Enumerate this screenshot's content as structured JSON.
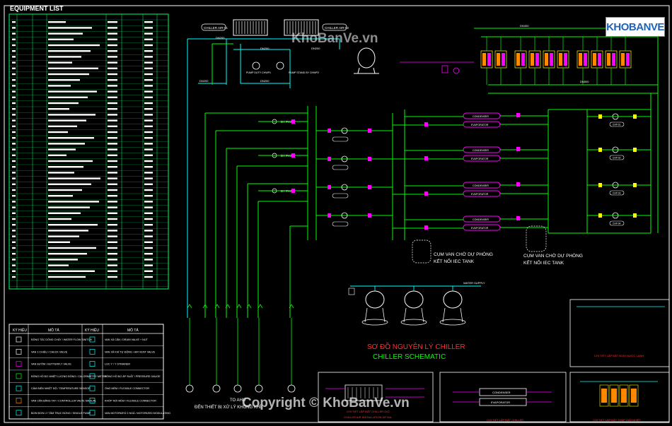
{
  "equipment_list": {
    "title": "EQUIPMENT LIST"
  },
  "legend": {
    "headers": [
      "KÝ HIỆU",
      "MÔ TẢ",
      "KÝ HIỆU",
      "MÔ TẢ"
    ],
    "left_items": [
      "ĐỒNG TẮC DÒNG CHẢY / WATER FLOW SWITCH",
      "VAN 1 CHIỀU / CHECK VALVE",
      "VAN BƯỚM / BUTTERFLY VALVE",
      "ĐỒNG HỒ ĐO NHIỆT LƯỢNG ĐỒNG / CALORIMETRY METER",
      "CẢM BIẾN NHIỆT ĐỘ / TEMPERATURE SENSOR",
      "VAN CÂN BẰNG TAY / CONTROLLER VALVE MANUAL",
      "BƠM ĐƠN LY TÂM TRỤC ĐỨNG / SINGLE PUMP"
    ],
    "right_items": [
      "VAN XẢ CẶN / DRAIN VALVE + NUT",
      "VAN XẢ KHÍ TỰ ĐỘNG / AIR VENT VALVE",
      "LỌC Y / Y STRAINER",
      "ĐỒNG HỒ ĐO ÁP SUẤT / PRESSURE GAUGE",
      "ỐNG MỀM / FLEXIBLE CONNECTOR",
      "KHỚP NỐI MỀM / FLEXIBLE CONNECTOR",
      "VAN MOTORIZED 2 NGẢ / MOTORIZED MODULATING"
    ]
  },
  "top_left": {
    "chiller_labels": [
      "CHILLER AIR-01",
      "CHILLER AIR-02"
    ],
    "pump_labels": [
      "PUMP DUTY CHWP1",
      "PUMP STAND BY CHWP2"
    ],
    "pipe_labels": [
      "DN200",
      "DN200",
      "DN200",
      "DN200",
      "DN200",
      "DN200"
    ]
  },
  "bypass_labels": [
    "BY PASS",
    "BY PASS",
    "BY PASS"
  ],
  "notes": {
    "left_reserve": "CỤM VAN CHỜ DỰ PHÒNG",
    "left_reserve_2": "KẾT NỐI IEC TANK",
    "right_reserve": "CỤM VAN CHỜ DỰ PHÒNG",
    "right_reserve_2": "KẾT NỐI IEC TANK",
    "to_ahu_1": "TO AHU",
    "to_ahu_2": "ĐẾN THIẾT BỊ XỬ LÝ KHÔNG KHÍ",
    "water_supply": "WATER SUPPLY",
    "dn300_small": "DN300"
  },
  "title_block": {
    "title_vi": "SƠ ĐỒ NGUYÊN LÝ CHILLER",
    "title_en": "CHILLER SCHEMATIC"
  },
  "details": {
    "d1": "CHI TIẾT LẮP ĐẶT CHILLER GIÓ",
    "d1b": "CHILLER AIR INSTALLATION DETAIL",
    "d2": "CHI TIẾT LẮP ĐẶT CHILLER",
    "d3": "CHI TIẾT LẮP ĐẶT BƠM NƯỚC LẠNH",
    "d4": "CHI TIẾT LẮP ĐẶT THÁP GIẢI NHIỆT"
  },
  "right_labels": {
    "pipe_top": "DN400",
    "pipe_mid": "DN500",
    "pumps": [
      "CHP-01",
      "CHP-02",
      "CHP-03",
      "CHP-04"
    ],
    "evaporator": "EVAPORATOR",
    "condenser": "CONDENSER"
  },
  "watermarks": {
    "top": "KhoBanVe.vn",
    "bottom": "Copyright © KhoBanVe.vn",
    "logo": "KHOBANVE"
  },
  "colors": {
    "background": "#000000",
    "cyan": "#00ffff",
    "green": "#00ff00",
    "magenta": "#ff00ff",
    "white": "#ffffff",
    "red": "#ff3333",
    "yellow": "#ffff00",
    "orange": "#ff8800"
  }
}
